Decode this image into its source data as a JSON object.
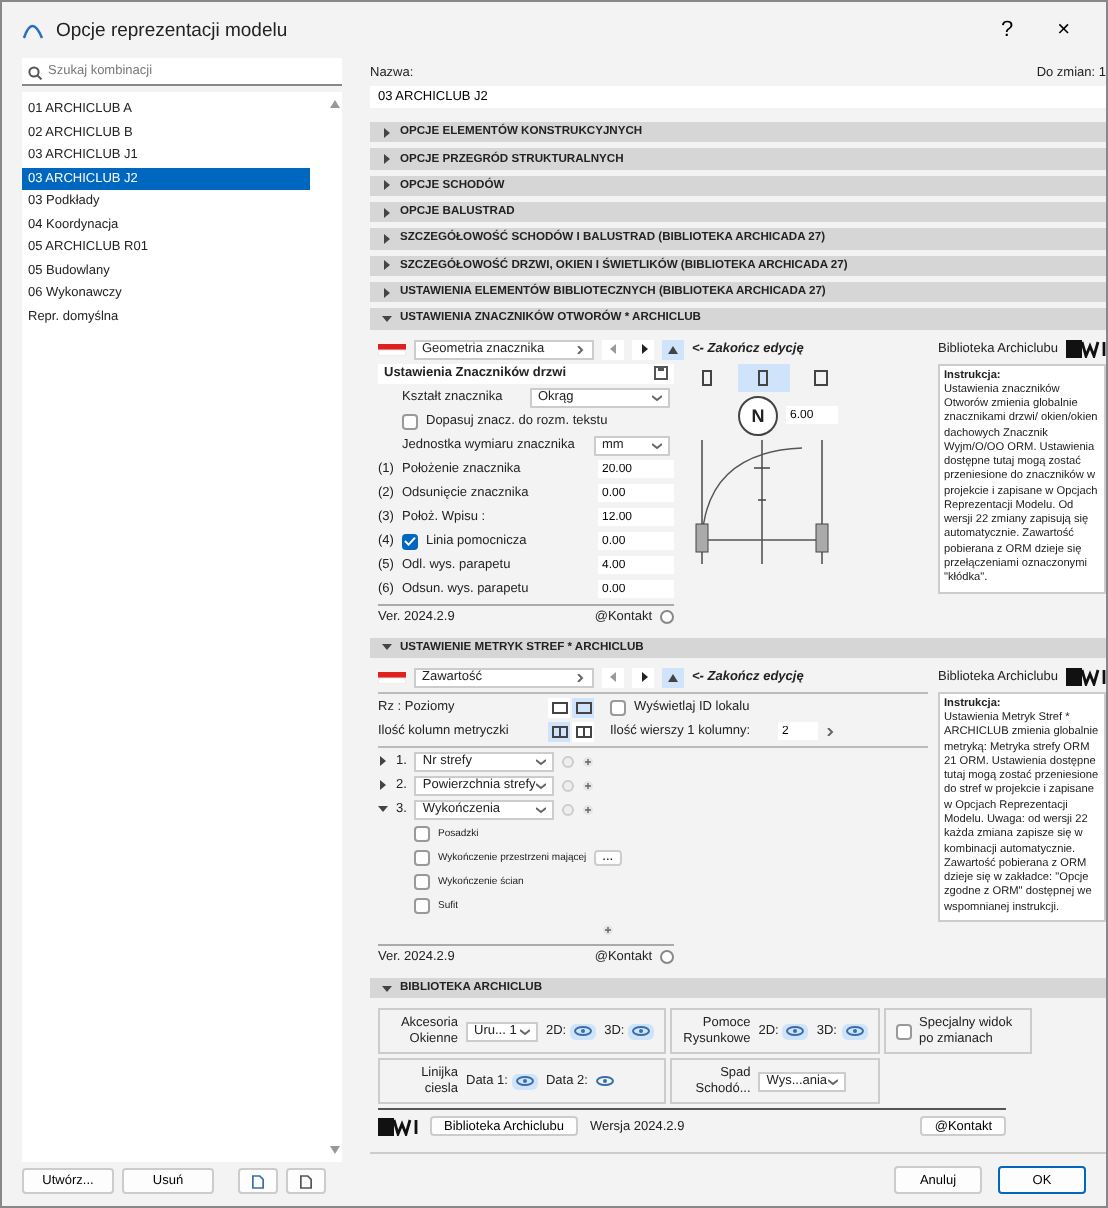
{
  "window": {
    "title": "Opcje reprezentacji modelu",
    "help": "?",
    "close": "×"
  },
  "sidebar": {
    "search_placeholder": "Szukaj kombinacji",
    "items": [
      {
        "label": "01 ARCHICLUB A",
        "selected": false
      },
      {
        "label": "02 ARCHICLUB B",
        "selected": false
      },
      {
        "label": "03 ARCHICLUB J1",
        "selected": false
      },
      {
        "label": "03 ARCHICLUB J2",
        "selected": true
      },
      {
        "label": "03 Podkłady",
        "selected": false
      },
      {
        "label": "04 Koordynacja",
        "selected": false
      },
      {
        "label": "05 ARCHICLUB R01",
        "selected": false
      },
      {
        "label": "05 Budowlany",
        "selected": false
      },
      {
        "label": "06 Wykonawczy",
        "selected": false
      },
      {
        "label": "Repr. domyślna",
        "selected": false
      }
    ],
    "buttons": [
      "Utwórz...",
      "Usuń"
    ]
  },
  "name_label": "Nazwa:",
  "name_value": "03 ARCHICLUB J2",
  "changes": "Do zmian: 1",
  "sections": [
    {
      "title": "OPCJE ELEMENTÓW KONSTRUKCYJNYCH",
      "expanded": false
    },
    {
      "title": "OPCJE PRZEGRÓD STRUKTURALNYCH",
      "expanded": false
    },
    {
      "title": "OPCJE SCHODÓW",
      "expanded": false
    },
    {
      "title": "OPCJE BALUSTRAD",
      "expanded": false
    },
    {
      "title": "SZCZEGÓŁOWOŚĆ SCHODÓW I BALUSTRAD (BIBLIOTEKA ARCHICADA 27)",
      "expanded": false
    },
    {
      "title": "SZCZEGÓŁOWOŚĆ DRZWI, OKIEN I ŚWIETLIKÓW (BIBLIOTEKA ARCHICADA 27)",
      "expanded": false
    },
    {
      "title": "USTAWIENIA ELEMENTÓW BIBLIOTECZNYCH (BIBLIOTEKA ARCHICADA 27)",
      "expanded": false
    },
    {
      "title": "USTAWIENIA ZNACZNIKÓW OTWORÓW * ARCHICLUB",
      "expanded": true,
      "kind": "markers"
    },
    {
      "title": "USTAWIENIE METRYK STREF * ARCHICLUB",
      "expanded": true,
      "kind": "zones"
    },
    {
      "title": "BIBLIOTEKA ARCHICLUB",
      "expanded": true,
      "kind": "library"
    }
  ],
  "markers": {
    "dropdown": "Geometria znacznika",
    "finish": "<- Zakończ edycję",
    "library": "Biblioteka Archiclubu",
    "form_title": "Ustawienia Znaczników drzwi",
    "shape": {
      "label": "Kształt znacznika",
      "value": "Okrąg"
    },
    "fit": {
      "label": "Dopasuj znacz. do rozm. tekstu",
      "checked": false
    },
    "unit": {
      "label": "Jednostka wymiaru znacznika",
      "value": "mm"
    },
    "rows": [
      {
        "num": "(1)",
        "label": "Położenie znacznika",
        "value": "20.00",
        "kind": "field"
      },
      {
        "num": "(2)",
        "label": "Odsunięcie znacznika",
        "value": "0.00",
        "kind": "field"
      },
      {
        "num": "(3)",
        "label": "Położ. Wpisu :",
        "value": "12.00",
        "kind": "field"
      },
      {
        "num": "(4)",
        "label": "Linia pomocnicza",
        "value": "0.00",
        "kind": "check",
        "checked": true
      },
      {
        "num": "(5)",
        "label": "Odl. wys. parapetu",
        "value": "4.00",
        "kind": "field"
      },
      {
        "num": "(6)",
        "label": "Odsun. wys. parapetu",
        "value": "0.00",
        "kind": "field"
      }
    ],
    "views": [
      {
        "selected": false
      },
      {
        "selected": true
      },
      {
        "selected": false
      }
    ],
    "letter": "N",
    "dimension": "6.00",
    "version": "Ver. 2024.2.9",
    "contact": "@Kontakt",
    "instructions_title": "Instrukcja:",
    "instructions": "Ustawienia znaczników Otworów zmienia globalnie znacznikami drzwi/ okien/okien dachowych Znacznik Wyjm/O/OO ORM. Ustawienia dostępne tutaj mogą zostać przeniesione do znaczników w projekcie i zapisane w Opcjach Reprezentacji Modelu. Od wersji 22 zmiany zapisują się automatycznie. Zawartość pobierana z ORM dzieje się przełączeniami oznaczonymi \"kłódka\"."
  },
  "zones": {
    "dropdown": "Zawartość",
    "finish": "<- Zakończ edycję",
    "library": "Biblioteka Archiclubu",
    "layout_label": "Rz : Poziomy",
    "layout_options": [
      {
        "selected": false
      },
      {
        "selected": true
      }
    ],
    "columns_label": "Ilość kolumn metryczki",
    "columns_options": [
      {
        "selected": true
      },
      {
        "selected": false
      }
    ],
    "show_id": {
      "label": "Wyświetlaj ID lokalu",
      "checked": false
    },
    "rows_label": "Ilość wierszy 1 kolumny:",
    "rows_value": "2",
    "items": [
      {
        "num": "1.",
        "label": "Nr strefy",
        "expanded": false
      },
      {
        "num": "2.",
        "label": "Powierzchnia strefy",
        "expanded": false
      },
      {
        "num": "3.",
        "label": "Wykończenia",
        "expanded": true,
        "children": [
          {
            "label": "Posadzki",
            "checked": false
          },
          {
            "label": "Wykończenie przestrzeni mającej",
            "checked": false
          },
          {
            "label": "Wykończenie ścian",
            "checked": false
          },
          {
            "label": "Sufit",
            "checked": false
          }
        ]
      }
    ],
    "more": "...",
    "version": "Ver. 2024.2.9",
    "contact": "@Kontakt",
    "instructions_title": "Instrukcja:",
    "instructions": "Ustawienia Metryk Stref * ARCHICLUB zmienia globalnie metryką: Metryka strefy ORM 21 ORM. Ustawienia dostępne tutaj mogą zostać przeniesione do stref w projekcie i zapisane w Opcjach Reprezentacji Modelu. Uwaga: od wersji 22 każda zmiana zapisze się w kombinacji automatycznie. Zawartość pobierana z ORM dzieje się w zakładce: \"Opcje zgodne z ORM\" dostępnej we wspomnianej instrukcji."
  },
  "library": {
    "accessories": {
      "label": "Akcesoria Okienne",
      "value": "Uru... 1",
      "eyes": [
        {
          "label": "2D:",
          "on": true
        },
        {
          "label": "3D:",
          "on": true
        }
      ]
    },
    "aids": {
      "label": "Pomoce Rysunkowe",
      "eyes": [
        {
          "label": "2D:",
          "on": true
        },
        {
          "label": "3D:",
          "on": true
        }
      ]
    },
    "special": {
      "label": "Specjalny widok po zmianach",
      "checked": false
    },
    "ruler": {
      "label": "Linijka ciesla",
      "eyes": [
        {
          "label": "Data 1:",
          "on": true
        },
        {
          "label": "Data 2:",
          "on": false
        }
      ]
    },
    "stairs": {
      "label": "Spad Schodó...",
      "value": "Wys...ania"
    },
    "library_button": "Biblioteka Archiclubu",
    "version": "Wersja 2024.2.9",
    "contact": "@Kontakt"
  },
  "footer": {
    "cancel": "Anuluj",
    "ok": "OK"
  }
}
